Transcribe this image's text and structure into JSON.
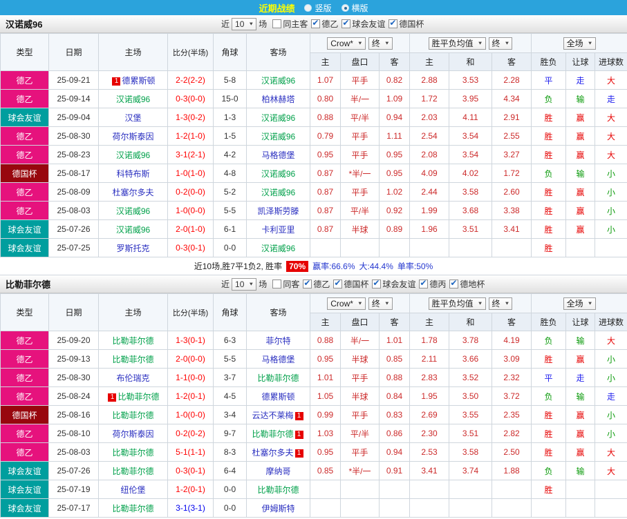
{
  "topbar": {
    "title": "近期战绩",
    "vertical": "竖版",
    "horizontal": "横版",
    "selected": "横版"
  },
  "labels": {
    "near": "近",
    "games": "场"
  },
  "table_header": {
    "type": "类型",
    "date": "日期",
    "home": "主场",
    "score": "比分(半场)",
    "corner": "角球",
    "away": "客场",
    "odds_select": "Crow*",
    "final_select": "终",
    "avg_select": "胜平负均值",
    "scope_select": "全场",
    "sub": {
      "h": "主",
      "handicap": "盘口",
      "a": "客",
      "eh": "主",
      "draw": "和",
      "ea": "客",
      "wdl": "胜负",
      "let": "让球",
      "goals": "进球数"
    }
  },
  "colors": {
    "topbar_bg": "#2ba3dc",
    "title": "#ffff00",
    "type_map": {
      "德乙": "#e6127d",
      "球会友谊": "#009e9e",
      "德国杯": "#98070e"
    },
    "focal_team": "#00a04a",
    "team": "#2a2fc0",
    "score": "#ff0000",
    "odds": "#cc2a2a",
    "badge_bg": "#e60000",
    "result_map": {
      "胜": "#e60000",
      "赢": "#e60000",
      "大": "#e60000",
      "平": "#2222ee",
      "走": "#2222ee",
      "负": "#0a9a0a",
      "输": "#0a9a0a",
      "小": "#0a9a0a"
    }
  },
  "summary": {
    "lead": "近10场,胜7平1负2, 胜率",
    "rate": "70%",
    "win_rate": "赢率:66.6%",
    "big_rate": "大:44.4%",
    "single_rate": "单率:50%"
  },
  "sections": [
    {
      "team": "汉诺威96",
      "count": "10",
      "filters": [
        {
          "label": "同主客",
          "checked": false
        },
        {
          "label": "德乙",
          "checked": true
        },
        {
          "label": "球会友谊",
          "checked": true
        },
        {
          "label": "德国杯",
          "checked": true
        }
      ],
      "rows": [
        {
          "type": "德乙",
          "date": "25-09-21",
          "home": "德累斯顿",
          "home_focal": false,
          "home_badge": "1",
          "score": "2-2(2-2)",
          "corner": "5-8",
          "away": "汉诺威96",
          "away_focal": true,
          "away_badge": "",
          "odds": [
            "1.07",
            "平手",
            "0.82"
          ],
          "euro": [
            "2.88",
            "3.53",
            "2.28"
          ],
          "results": [
            "平",
            "走",
            "大"
          ]
        },
        {
          "type": "德乙",
          "date": "25-09-14",
          "home": "汉诺威96",
          "home_focal": true,
          "home_badge": "",
          "score": "0-3(0-0)",
          "corner": "15-0",
          "away": "柏林赫塔",
          "away_focal": false,
          "away_badge": "",
          "odds": [
            "0.80",
            "半/一",
            "1.09"
          ],
          "euro": [
            "1.72",
            "3.95",
            "4.34"
          ],
          "results": [
            "负",
            "输",
            "走"
          ]
        },
        {
          "type": "球会友谊",
          "date": "25-09-04",
          "home": "汉堡",
          "home_focal": false,
          "home_badge": "",
          "score": "1-3(0-2)",
          "corner": "1-3",
          "away": "汉诺威96",
          "away_focal": true,
          "away_badge": "",
          "odds": [
            "0.88",
            "平/半",
            "0.94"
          ],
          "euro": [
            "2.03",
            "4.11",
            "2.91"
          ],
          "results": [
            "胜",
            "赢",
            "大"
          ]
        },
        {
          "type": "德乙",
          "date": "25-08-30",
          "home": "荷尔斯泰因",
          "home_focal": false,
          "home_badge": "",
          "score": "1-2(1-0)",
          "corner": "1-5",
          "away": "汉诺威96",
          "away_focal": true,
          "away_badge": "",
          "odds": [
            "0.79",
            "平手",
            "1.11"
          ],
          "euro": [
            "2.54",
            "3.54",
            "2.55"
          ],
          "results": [
            "胜",
            "赢",
            "大"
          ]
        },
        {
          "type": "德乙",
          "date": "25-08-23",
          "home": "汉诺威96",
          "home_focal": true,
          "home_badge": "",
          "score": "3-1(2-1)",
          "corner": "4-2",
          "away": "马格德堡",
          "away_focal": false,
          "away_badge": "",
          "odds": [
            "0.95",
            "平手",
            "0.95"
          ],
          "euro": [
            "2.08",
            "3.54",
            "3.27"
          ],
          "results": [
            "胜",
            "赢",
            "大"
          ]
        },
        {
          "type": "德国杯",
          "date": "25-08-17",
          "home": "科特布斯",
          "home_focal": false,
          "home_badge": "",
          "score": "1-0(1-0)",
          "corner": "4-8",
          "away": "汉诺威96",
          "away_focal": true,
          "away_badge": "",
          "odds": [
            "0.87",
            "*半/一",
            "0.95"
          ],
          "euro": [
            "4.09",
            "4.02",
            "1.72"
          ],
          "results": [
            "负",
            "输",
            "小"
          ]
        },
        {
          "type": "德乙",
          "date": "25-08-09",
          "home": "杜塞尔多夫",
          "home_focal": false,
          "home_badge": "",
          "score": "0-2(0-0)",
          "corner": "5-2",
          "away": "汉诺威96",
          "away_focal": true,
          "away_badge": "",
          "odds": [
            "0.87",
            "平手",
            "1.02"
          ],
          "euro": [
            "2.44",
            "3.58",
            "2.60"
          ],
          "results": [
            "胜",
            "赢",
            "小"
          ]
        },
        {
          "type": "德乙",
          "date": "25-08-03",
          "home": "汉诺威96",
          "home_focal": true,
          "home_badge": "",
          "score": "1-0(0-0)",
          "corner": "5-5",
          "away": "凯泽斯劳滕",
          "away_focal": false,
          "away_badge": "",
          "odds": [
            "0.87",
            "平/半",
            "0.92"
          ],
          "euro": [
            "1.99",
            "3.68",
            "3.38"
          ],
          "results": [
            "胜",
            "赢",
            "小"
          ]
        },
        {
          "type": "球会友谊",
          "date": "25-07-26",
          "home": "汉诺威96",
          "home_focal": true,
          "home_badge": "",
          "score": "2-0(1-0)",
          "corner": "6-1",
          "away": "卡利亚里",
          "away_focal": false,
          "away_badge": "",
          "odds": [
            "0.87",
            "半球",
            "0.89"
          ],
          "euro": [
            "1.96",
            "3.51",
            "3.41"
          ],
          "results": [
            "胜",
            "赢",
            "小"
          ]
        },
        {
          "type": "球会友谊",
          "date": "25-07-25",
          "home": "罗斯托克",
          "home_focal": false,
          "home_badge": "",
          "score": "0-3(0-1)",
          "corner": "0-0",
          "away": "汉诺威96",
          "away_focal": true,
          "away_badge": "",
          "odds": [
            "",
            "",
            ""
          ],
          "euro": [
            "",
            "",
            ""
          ],
          "results": [
            "胜",
            "",
            ""
          ]
        }
      ]
    },
    {
      "team": "比勒菲尔德",
      "count": "10",
      "filters": [
        {
          "label": "同客",
          "checked": false
        },
        {
          "label": "德乙",
          "checked": true
        },
        {
          "label": "德国杯",
          "checked": true
        },
        {
          "label": "球会友谊",
          "checked": true
        },
        {
          "label": "德丙",
          "checked": true
        },
        {
          "label": "德地杯",
          "checked": true
        }
      ],
      "rows": [
        {
          "type": "德乙",
          "date": "25-09-20",
          "home": "比勒菲尔德",
          "home_focal": true,
          "home_badge": "",
          "score": "1-3(0-1)",
          "corner": "6-3",
          "away": "菲尔特",
          "away_focal": false,
          "away_badge": "",
          "odds": [
            "0.88",
            "半/一",
            "1.01"
          ],
          "euro": [
            "1.78",
            "3.78",
            "4.19"
          ],
          "results": [
            "负",
            "输",
            "大"
          ]
        },
        {
          "type": "德乙",
          "date": "25-09-13",
          "home": "比勒菲尔德",
          "home_focal": true,
          "home_badge": "",
          "score": "2-0(0-0)",
          "corner": "5-5",
          "away": "马格德堡",
          "away_focal": false,
          "away_badge": "",
          "odds": [
            "0.95",
            "半球",
            "0.85"
          ],
          "euro": [
            "2.11",
            "3.66",
            "3.09"
          ],
          "results": [
            "胜",
            "赢",
            "小"
          ]
        },
        {
          "type": "德乙",
          "date": "25-08-30",
          "home": "布伦瑞克",
          "home_focal": false,
          "home_badge": "",
          "score": "1-1(0-0)",
          "corner": "3-7",
          "away": "比勒菲尔德",
          "away_focal": true,
          "away_badge": "",
          "odds": [
            "1.01",
            "平手",
            "0.88"
          ],
          "euro": [
            "2.83",
            "3.52",
            "2.32"
          ],
          "results": [
            "平",
            "走",
            "小"
          ]
        },
        {
          "type": "德乙",
          "date": "25-08-24",
          "home": "比勒菲尔德",
          "home_focal": true,
          "home_badge": "1",
          "score": "1-2(0-1)",
          "corner": "4-5",
          "away": "德累斯顿",
          "away_focal": false,
          "away_badge": "",
          "odds": [
            "1.05",
            "半球",
            "0.84"
          ],
          "euro": [
            "1.95",
            "3.50",
            "3.72"
          ],
          "results": [
            "负",
            "输",
            "走"
          ]
        },
        {
          "type": "德国杯",
          "date": "25-08-16",
          "home": "比勒菲尔德",
          "home_focal": true,
          "home_badge": "",
          "score": "1-0(0-0)",
          "corner": "3-4",
          "away": "云达不莱梅",
          "away_focal": false,
          "away_badge": "1",
          "odds": [
            "0.99",
            "平手",
            "0.83"
          ],
          "euro": [
            "2.69",
            "3.55",
            "2.35"
          ],
          "results": [
            "胜",
            "赢",
            "小"
          ]
        },
        {
          "type": "德乙",
          "date": "25-08-10",
          "home": "荷尔斯泰因",
          "home_focal": false,
          "home_badge": "",
          "score": "0-2(0-2)",
          "corner": "9-7",
          "away": "比勒菲尔德",
          "away_focal": true,
          "away_badge": "1",
          "odds": [
            "1.03",
            "平/半",
            "0.86"
          ],
          "euro": [
            "2.30",
            "3.51",
            "2.82"
          ],
          "results": [
            "胜",
            "赢",
            "小"
          ]
        },
        {
          "type": "德乙",
          "date": "25-08-03",
          "home": "比勒菲尔德",
          "home_focal": true,
          "home_badge": "",
          "score": "5-1(1-1)",
          "corner": "8-3",
          "away": "杜塞尔多夫",
          "away_focal": false,
          "away_badge": "1",
          "odds": [
            "0.95",
            "平手",
            "0.94"
          ],
          "euro": [
            "2.53",
            "3.58",
            "2.50"
          ],
          "results": [
            "胜",
            "赢",
            "大"
          ]
        },
        {
          "type": "球会友谊",
          "date": "25-07-26",
          "home": "比勒菲尔德",
          "home_focal": true,
          "home_badge": "",
          "score": "0-3(0-1)",
          "corner": "6-4",
          "away": "摩纳哥",
          "away_focal": false,
          "away_badge": "",
          "odds": [
            "0.85",
            "*半/一",
            "0.91"
          ],
          "euro": [
            "3.41",
            "3.74",
            "1.88"
          ],
          "results": [
            "负",
            "输",
            "大"
          ]
        },
        {
          "type": "球会友谊",
          "date": "25-07-19",
          "home": "纽伦堡",
          "home_focal": false,
          "home_badge": "",
          "score": "1-2(0-1)",
          "corner": "0-0",
          "away": "比勒菲尔德",
          "away_focal": true,
          "away_badge": "",
          "odds": [
            "",
            "",
            ""
          ],
          "euro": [
            "",
            "",
            ""
          ],
          "results": [
            "胜",
            "",
            ""
          ]
        },
        {
          "type": "球会友谊",
          "date": "25-07-17",
          "home": "比勒菲尔德",
          "home_focal": true,
          "home_badge": "",
          "score": "3-1(3-1)",
          "score_color": "#0000ee",
          "corner": "0-0",
          "away": "伊姆斯特",
          "away_focal": false,
          "away_badge": "",
          "odds": [
            "",
            "",
            ""
          ],
          "euro": [
            "",
            "",
            ""
          ],
          "results": [
            "",
            "",
            ""
          ]
        }
      ]
    }
  ]
}
